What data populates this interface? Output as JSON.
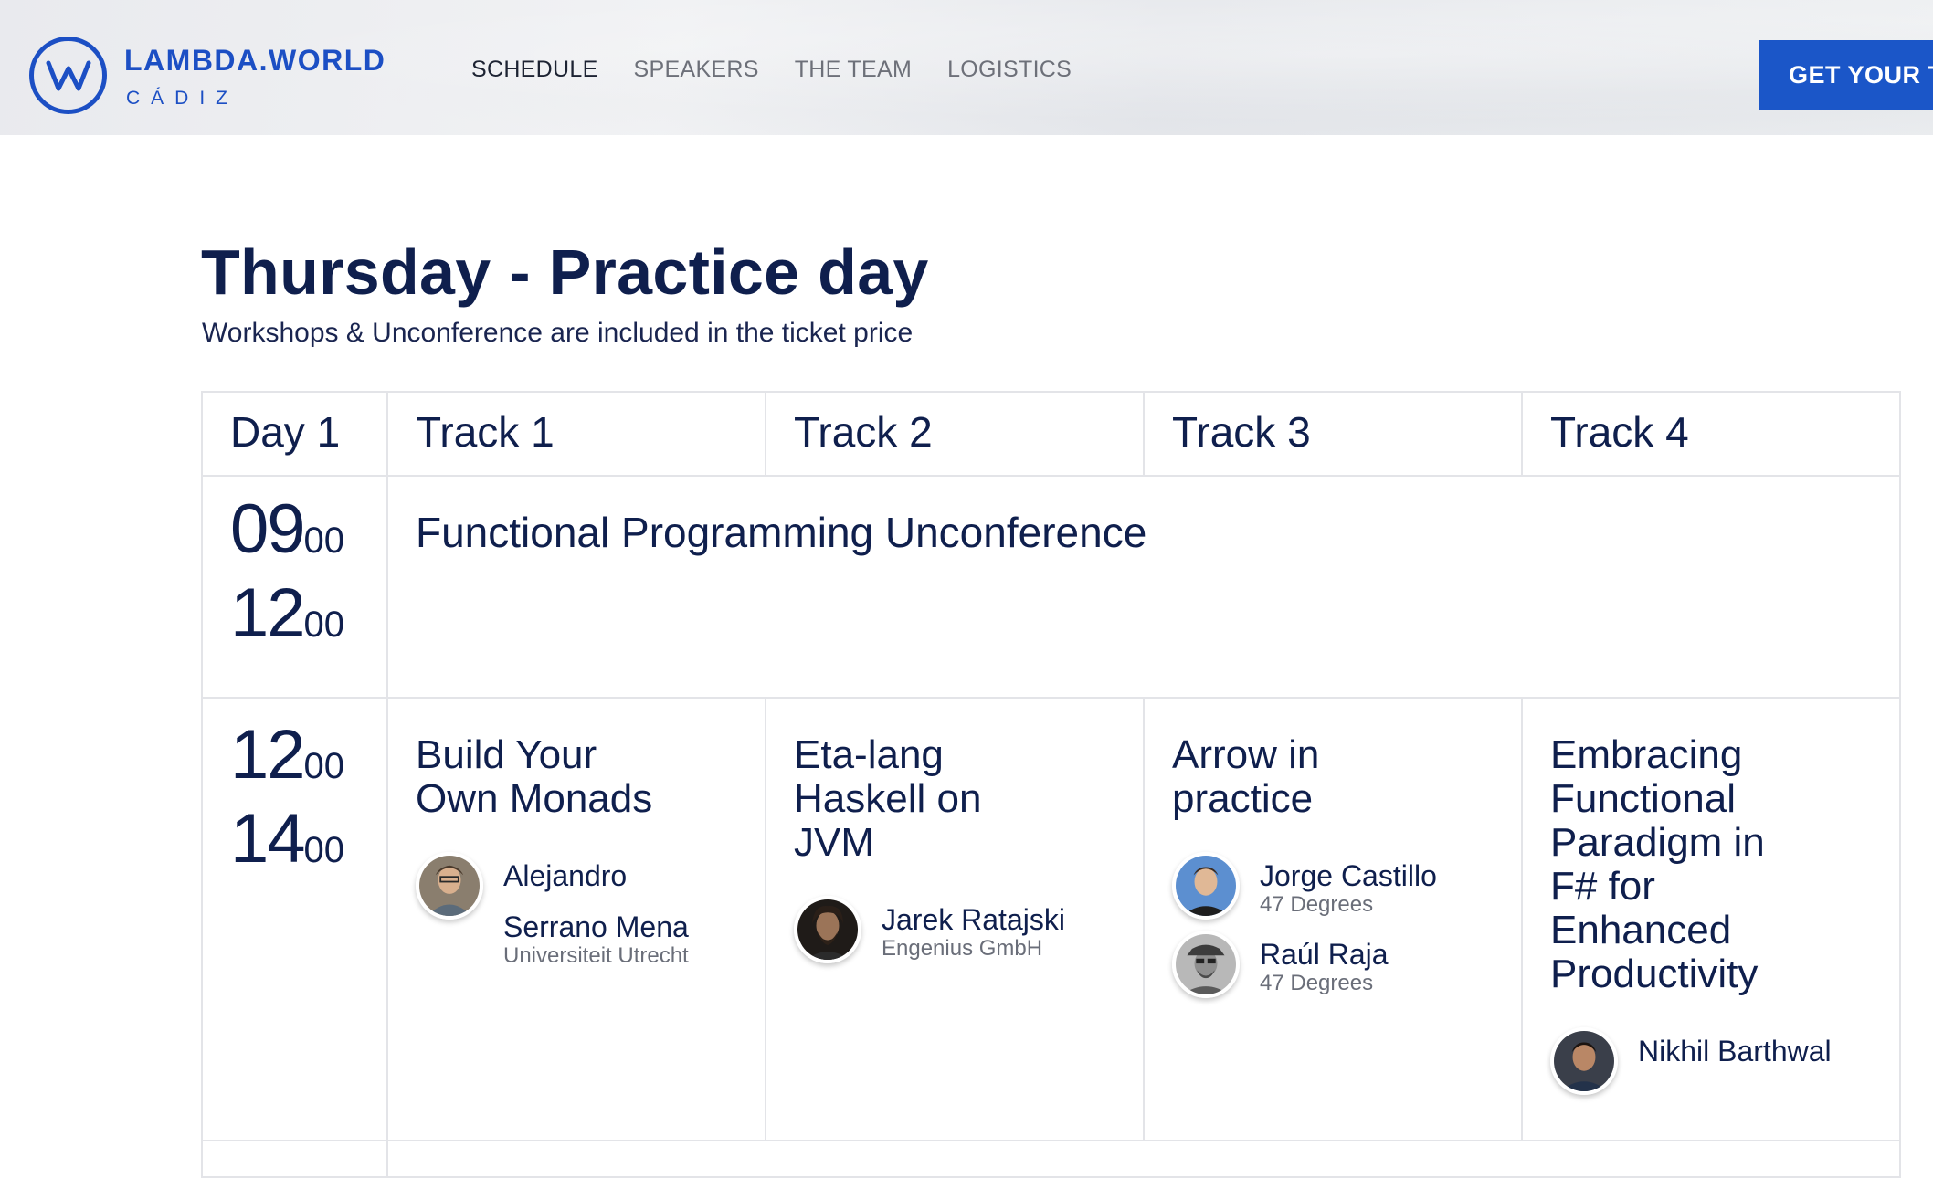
{
  "header": {
    "logo_title": "LAMBDA.WORLD",
    "logo_subtitle": "CÁDIZ",
    "nav": [
      "SCHEDULE",
      "SPEAKERS",
      "THE TEAM",
      "LOGISTICS"
    ],
    "active_nav": "SCHEDULE",
    "ticket_button": "GET YOUR T"
  },
  "page": {
    "title": "Thursday - Practice day",
    "subtitle": "Workshops & Unconference are included in the ticket price"
  },
  "table": {
    "headers": [
      "Day 1",
      "Track 1",
      "Track 2",
      "Track 3",
      "Track 4"
    ],
    "slot1": {
      "start_h": "09",
      "start_m": "00",
      "end_h": "12",
      "end_m": "00",
      "title": "Functional Programming Unconference"
    },
    "slot2": {
      "start_h": "12",
      "start_m": "00",
      "end_h": "14",
      "end_m": "00",
      "talks": [
        {
          "title": "Build Your Own Monads",
          "speakers": [
            {
              "name_line1": "Alejandro",
              "name_line2": "Serrano Mena",
              "company": "Universiteit Utrecht"
            }
          ]
        },
        {
          "title": "Eta-lang Haskell on JVM",
          "speakers": [
            {
              "name": "Jarek Ratajski",
              "company": "Engenius GmbH"
            }
          ]
        },
        {
          "title": "Arrow in practice",
          "speakers": [
            {
              "name": "Jorge Castillo",
              "company": "47 Degrees"
            },
            {
              "name": "Raúl Raja",
              "company": "47 Degrees"
            }
          ]
        },
        {
          "title": "Embracing Functional Paradigm in F# for Enhanced Productivity",
          "speakers": [
            {
              "name": "Nikhil Barthwal",
              "company": ""
            }
          ]
        }
      ]
    }
  },
  "colors": {
    "brand_blue": "#1c4fc4",
    "button_blue": "#1b56c8",
    "text_navy": "#0f1f4d",
    "border_gray": "#e3e4e8"
  },
  "icons": [
    "lambda-world-logo-icon",
    "avatar-photo"
  ]
}
